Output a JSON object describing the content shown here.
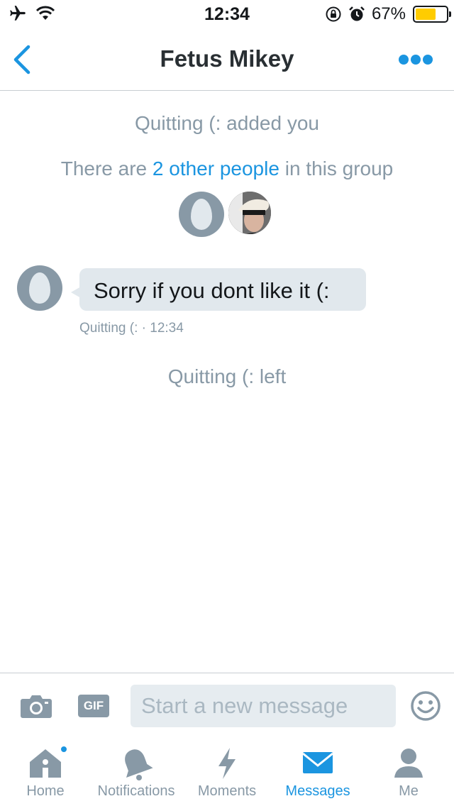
{
  "status_bar": {
    "time": "12:34",
    "battery_percent": "67%",
    "battery_level": 0.67,
    "icons": [
      "airplane-icon",
      "wifi-icon",
      "rotation-lock-icon",
      "alarm-icon",
      "battery-icon"
    ]
  },
  "header": {
    "title": "Fetus Mikey",
    "back_icon": "chevron-left-icon",
    "more_icon": "more-dots-icon"
  },
  "conversation": {
    "added_notice": "Quitting (: added you",
    "group_info": {
      "prefix": "There are ",
      "link": "2 other people",
      "suffix": " in this group"
    },
    "messages": [
      {
        "text": "Sorry if you dont like it (:",
        "meta": "Quitting (: · 12:34"
      }
    ],
    "left_notice": "Quitting (: left"
  },
  "composer": {
    "placeholder": "Start a new message",
    "value": "",
    "gif_label": "GIF",
    "icons": [
      "camera-icon",
      "emoji-icon"
    ]
  },
  "tab_bar": {
    "tabs": [
      {
        "label": "Home",
        "icon": "home-icon",
        "active": false,
        "badge": true
      },
      {
        "label": "Notifications",
        "icon": "bell-icon",
        "active": false
      },
      {
        "label": "Moments",
        "icon": "lightning-icon",
        "active": false
      },
      {
        "label": "Messages",
        "icon": "envelope-icon",
        "active": true
      },
      {
        "label": "Me",
        "icon": "person-icon",
        "active": false
      }
    ]
  },
  "colors": {
    "accent": "#1b95e0",
    "secondary_text": "#8899a6",
    "bubble_bg": "#e1e8ed",
    "battery_fill": "#ffcc00"
  }
}
